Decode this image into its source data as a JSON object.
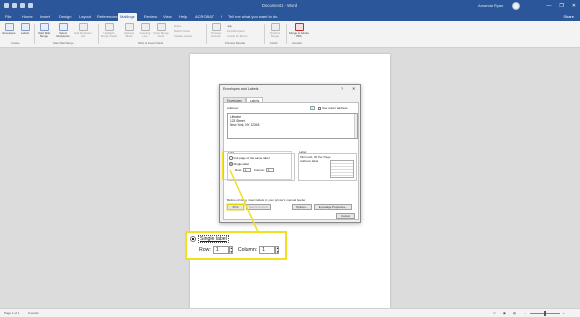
{
  "title_bar": {
    "document_title": "Document1 - Word",
    "user_name": "Amanda Ryan",
    "minimize": "—",
    "restore": "❐",
    "close": "✕"
  },
  "tabs": [
    "File",
    "Home",
    "Insert",
    "Design",
    "Layout",
    "References",
    "Mailings",
    "Review",
    "View",
    "Help",
    "ACROBAT"
  ],
  "active_tab": "Mailings",
  "tell_me": "Tell me what you want to do",
  "share": "Share",
  "ribbon": {
    "envelopes": "Envelopes",
    "labels": "Labels",
    "start_mail_merge": "Start Mail Merge",
    "select_recipients": "Select Recipients",
    "edit_recipient_list": "Edit Recipient List",
    "highlight_merge_fields": "Highlight Merge Fields",
    "address_block": "Address Block",
    "greeting_line": "Greeting Line",
    "insert_merge_field": "Insert Merge Field",
    "rules": "Rules",
    "match_fields": "Match Fields",
    "update_labels": "Update Labels",
    "preview_results": "Preview Results",
    "find_recipient": "Find Recipient",
    "check_for_errors": "Check for Errors",
    "finish_merge": "Finish & Merge",
    "merge_to_adobe_pdf": "Merge to Adobe PDF",
    "groups": {
      "create": "Create",
      "start_mail_merge": "Start Mail Merge",
      "write_insert_fields": "Write & Insert Fields",
      "preview_results": "Preview Results",
      "finish": "Finish",
      "acrobat": "Acrobat"
    }
  },
  "dialog": {
    "title": "Envelopes and Labels",
    "help": "?",
    "close": "✕",
    "tab_envelopes": "Envelopes",
    "tab_labels": "Labels",
    "address_label": "Address:",
    "use_return_address": "Use return address",
    "address_lines": [
      "Lifewire",
      "123 Street",
      "New York, NY 12345"
    ],
    "print_heading": "Print",
    "full_page_option": "Full page of the same label",
    "single_label_option": "Single label",
    "row_label": "Row:",
    "row_value": "1",
    "column_label": "Column:",
    "column_value": "1",
    "label_heading": "Label",
    "label_name": "Microsoft, 30 Per Page",
    "label_type": "Address label",
    "manual_feed_note": "Before printing, insert labels in your printer's manual feeder.",
    "print_button": "Print",
    "new_document_button": "New Document",
    "options_button": "Options...",
    "epostage_button": "E-postage Properties...",
    "cancel_button": "Cancel"
  },
  "callout": {
    "single_label": "Single label",
    "row_label": "Row:",
    "row_value": "1",
    "column_label": "Column:",
    "column_value": "1"
  },
  "status_bar": {
    "page": "Page 1 of 1",
    "words": "0 words"
  },
  "colors": {
    "word_blue": "#2b579a",
    "highlight_yellow": "#efe022"
  }
}
